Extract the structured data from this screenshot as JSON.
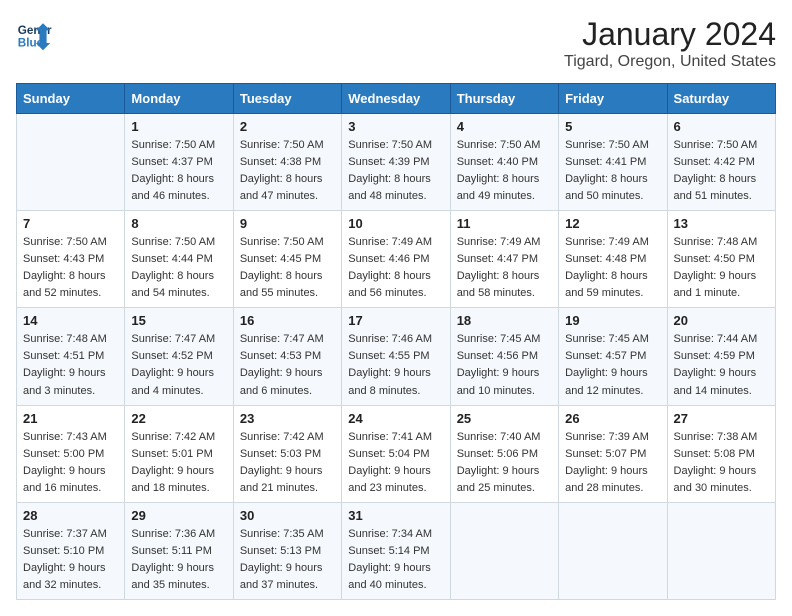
{
  "header": {
    "logo_line1": "General",
    "logo_line2": "Blue",
    "title": "January 2024",
    "subtitle": "Tigard, Oregon, United States"
  },
  "days_of_week": [
    "Sunday",
    "Monday",
    "Tuesday",
    "Wednesday",
    "Thursday",
    "Friday",
    "Saturday"
  ],
  "weeks": [
    [
      {
        "day": "",
        "sunrise": "",
        "sunset": "",
        "daylight": ""
      },
      {
        "day": "1",
        "sunrise": "Sunrise: 7:50 AM",
        "sunset": "Sunset: 4:37 PM",
        "daylight": "Daylight: 8 hours and 46 minutes."
      },
      {
        "day": "2",
        "sunrise": "Sunrise: 7:50 AM",
        "sunset": "Sunset: 4:38 PM",
        "daylight": "Daylight: 8 hours and 47 minutes."
      },
      {
        "day": "3",
        "sunrise": "Sunrise: 7:50 AM",
        "sunset": "Sunset: 4:39 PM",
        "daylight": "Daylight: 8 hours and 48 minutes."
      },
      {
        "day": "4",
        "sunrise": "Sunrise: 7:50 AM",
        "sunset": "Sunset: 4:40 PM",
        "daylight": "Daylight: 8 hours and 49 minutes."
      },
      {
        "day": "5",
        "sunrise": "Sunrise: 7:50 AM",
        "sunset": "Sunset: 4:41 PM",
        "daylight": "Daylight: 8 hours and 50 minutes."
      },
      {
        "day": "6",
        "sunrise": "Sunrise: 7:50 AM",
        "sunset": "Sunset: 4:42 PM",
        "daylight": "Daylight: 8 hours and 51 minutes."
      }
    ],
    [
      {
        "day": "7",
        "sunrise": "Sunrise: 7:50 AM",
        "sunset": "Sunset: 4:43 PM",
        "daylight": "Daylight: 8 hours and 52 minutes."
      },
      {
        "day": "8",
        "sunrise": "Sunrise: 7:50 AM",
        "sunset": "Sunset: 4:44 PM",
        "daylight": "Daylight: 8 hours and 54 minutes."
      },
      {
        "day": "9",
        "sunrise": "Sunrise: 7:50 AM",
        "sunset": "Sunset: 4:45 PM",
        "daylight": "Daylight: 8 hours and 55 minutes."
      },
      {
        "day": "10",
        "sunrise": "Sunrise: 7:49 AM",
        "sunset": "Sunset: 4:46 PM",
        "daylight": "Daylight: 8 hours and 56 minutes."
      },
      {
        "day": "11",
        "sunrise": "Sunrise: 7:49 AM",
        "sunset": "Sunset: 4:47 PM",
        "daylight": "Daylight: 8 hours and 58 minutes."
      },
      {
        "day": "12",
        "sunrise": "Sunrise: 7:49 AM",
        "sunset": "Sunset: 4:48 PM",
        "daylight": "Daylight: 8 hours and 59 minutes."
      },
      {
        "day": "13",
        "sunrise": "Sunrise: 7:48 AM",
        "sunset": "Sunset: 4:50 PM",
        "daylight": "Daylight: 9 hours and 1 minute."
      }
    ],
    [
      {
        "day": "14",
        "sunrise": "Sunrise: 7:48 AM",
        "sunset": "Sunset: 4:51 PM",
        "daylight": "Daylight: 9 hours and 3 minutes."
      },
      {
        "day": "15",
        "sunrise": "Sunrise: 7:47 AM",
        "sunset": "Sunset: 4:52 PM",
        "daylight": "Daylight: 9 hours and 4 minutes."
      },
      {
        "day": "16",
        "sunrise": "Sunrise: 7:47 AM",
        "sunset": "Sunset: 4:53 PM",
        "daylight": "Daylight: 9 hours and 6 minutes."
      },
      {
        "day": "17",
        "sunrise": "Sunrise: 7:46 AM",
        "sunset": "Sunset: 4:55 PM",
        "daylight": "Daylight: 9 hours and 8 minutes."
      },
      {
        "day": "18",
        "sunrise": "Sunrise: 7:45 AM",
        "sunset": "Sunset: 4:56 PM",
        "daylight": "Daylight: 9 hours and 10 minutes."
      },
      {
        "day": "19",
        "sunrise": "Sunrise: 7:45 AM",
        "sunset": "Sunset: 4:57 PM",
        "daylight": "Daylight: 9 hours and 12 minutes."
      },
      {
        "day": "20",
        "sunrise": "Sunrise: 7:44 AM",
        "sunset": "Sunset: 4:59 PM",
        "daylight": "Daylight: 9 hours and 14 minutes."
      }
    ],
    [
      {
        "day": "21",
        "sunrise": "Sunrise: 7:43 AM",
        "sunset": "Sunset: 5:00 PM",
        "daylight": "Daylight: 9 hours and 16 minutes."
      },
      {
        "day": "22",
        "sunrise": "Sunrise: 7:42 AM",
        "sunset": "Sunset: 5:01 PM",
        "daylight": "Daylight: 9 hours and 18 minutes."
      },
      {
        "day": "23",
        "sunrise": "Sunrise: 7:42 AM",
        "sunset": "Sunset: 5:03 PM",
        "daylight": "Daylight: 9 hours and 21 minutes."
      },
      {
        "day": "24",
        "sunrise": "Sunrise: 7:41 AM",
        "sunset": "Sunset: 5:04 PM",
        "daylight": "Daylight: 9 hours and 23 minutes."
      },
      {
        "day": "25",
        "sunrise": "Sunrise: 7:40 AM",
        "sunset": "Sunset: 5:06 PM",
        "daylight": "Daylight: 9 hours and 25 minutes."
      },
      {
        "day": "26",
        "sunrise": "Sunrise: 7:39 AM",
        "sunset": "Sunset: 5:07 PM",
        "daylight": "Daylight: 9 hours and 28 minutes."
      },
      {
        "day": "27",
        "sunrise": "Sunrise: 7:38 AM",
        "sunset": "Sunset: 5:08 PM",
        "daylight": "Daylight: 9 hours and 30 minutes."
      }
    ],
    [
      {
        "day": "28",
        "sunrise": "Sunrise: 7:37 AM",
        "sunset": "Sunset: 5:10 PM",
        "daylight": "Daylight: 9 hours and 32 minutes."
      },
      {
        "day": "29",
        "sunrise": "Sunrise: 7:36 AM",
        "sunset": "Sunset: 5:11 PM",
        "daylight": "Daylight: 9 hours and 35 minutes."
      },
      {
        "day": "30",
        "sunrise": "Sunrise: 7:35 AM",
        "sunset": "Sunset: 5:13 PM",
        "daylight": "Daylight: 9 hours and 37 minutes."
      },
      {
        "day": "31",
        "sunrise": "Sunrise: 7:34 AM",
        "sunset": "Sunset: 5:14 PM",
        "daylight": "Daylight: 9 hours and 40 minutes."
      },
      {
        "day": "",
        "sunrise": "",
        "sunset": "",
        "daylight": ""
      },
      {
        "day": "",
        "sunrise": "",
        "sunset": "",
        "daylight": ""
      },
      {
        "day": "",
        "sunrise": "",
        "sunset": "",
        "daylight": ""
      }
    ]
  ]
}
